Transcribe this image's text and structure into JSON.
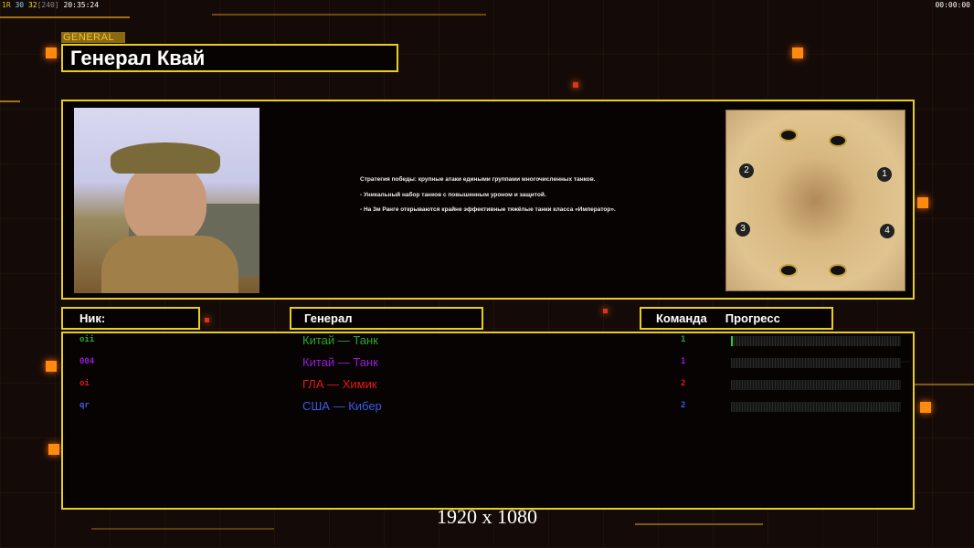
{
  "hud": {
    "fps_a": "1R",
    "fps_b": "30",
    "fps_c": "32",
    "fps_d": "[240]",
    "time": "20:35:24",
    "clock": "00:00:00"
  },
  "general": {
    "tag": "GENERAL",
    "name": "Генерал Квай",
    "description": [
      "Стратегия победы: крупные атаки едиными группами многочисленных танков.",
      "- Уникальный набор танков с повышенным уроном и защитой.",
      "- На 3м Ранге открываются крайне эффективные тяжёлые танки класса «Император»."
    ]
  },
  "columns": {
    "nick": "Ник:",
    "general": "Генерал",
    "team": "Команда",
    "progress": "Прогресс"
  },
  "players": [
    {
      "nick": "oii",
      "general": "Китай — Танк",
      "team": "1",
      "progress": 1,
      "color": "#2aa82a"
    },
    {
      "nick": "004",
      "general": "Китай — Танк",
      "team": "1",
      "progress": 0,
      "color": "#9a1ad8"
    },
    {
      "nick": "oi",
      "general": "ГЛА — Химик",
      "team": "2",
      "progress": 0,
      "color": "#e81818"
    },
    {
      "nick": "qr",
      "general": "США — Кибер",
      "team": "2",
      "progress": 0,
      "color": "#3a5ae8"
    }
  ],
  "map": {
    "start_positions": [
      "1",
      "2",
      "3",
      "4"
    ]
  },
  "resolution": "1920 x 1080",
  "colors": {
    "accent": "#e8cf1e",
    "orange": "#ff8a10"
  }
}
